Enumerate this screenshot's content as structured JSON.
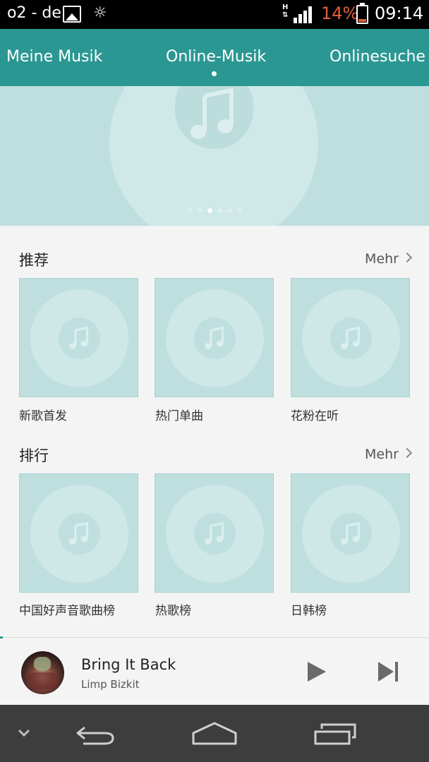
{
  "status_bar": {
    "carrier": "o2 - de",
    "network": "H",
    "battery_percent": "14%",
    "time": "09:14",
    "icons": [
      "gallery-icon",
      "brightness-icon",
      "signal-icon",
      "battery-icon"
    ],
    "battery_color": "#e0603a"
  },
  "tabs": [
    {
      "label": "Meine Musik"
    },
    {
      "label": "Online-Musik",
      "active": true
    },
    {
      "label": "Onlinesuche"
    }
  ],
  "banner": {
    "page_count": 6,
    "active_page": 2
  },
  "sections": [
    {
      "title": "推荐",
      "more_label": "Mehr",
      "items": [
        {
          "label": "新歌首发"
        },
        {
          "label": "热门单曲"
        },
        {
          "label": "花粉在听"
        }
      ]
    },
    {
      "title": "排行",
      "more_label": "Mehr",
      "items": [
        {
          "label": "中国好声音歌曲榜"
        },
        {
          "label": "热歌榜"
        },
        {
          "label": "日韩榜"
        }
      ]
    }
  ],
  "player": {
    "title": "Bring It Back",
    "artist": "Limp Bizkit",
    "progress": 0.005
  },
  "colors": {
    "accent": "#2b9792",
    "placeholder_bg": "#bfdfdf",
    "placeholder_disc": "#cee7e7",
    "nav_bg": "#3d3d3d"
  }
}
